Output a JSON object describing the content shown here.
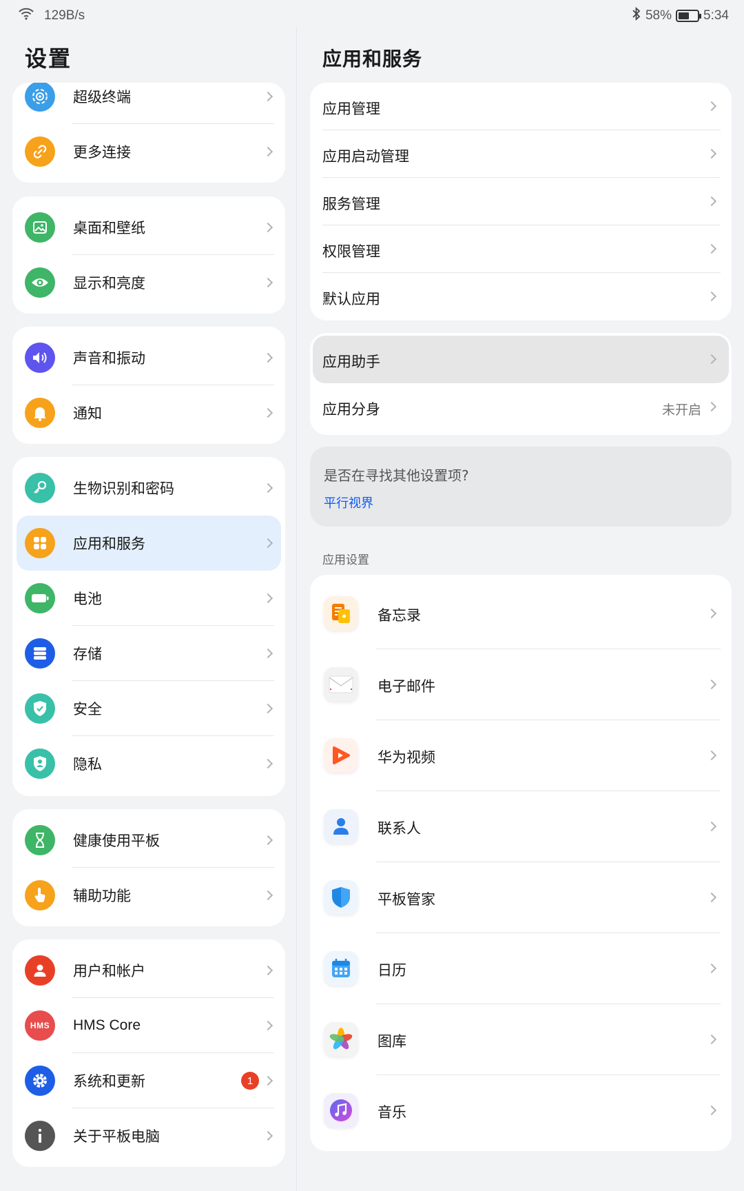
{
  "status": {
    "net_speed": "129B/s",
    "battery_pct": "58%",
    "battery_level": 0.58,
    "time": "5:34"
  },
  "left": {
    "title": "设置",
    "groups": [
      [
        {
          "label": "超级终端",
          "icon": "super-device-icon",
          "color": "#3b9ee8"
        },
        {
          "label": "更多连接",
          "icon": "link-icon",
          "color": "#f7a21b"
        }
      ],
      [
        {
          "label": "桌面和壁纸",
          "icon": "wallpaper-icon",
          "color": "#3fb567"
        },
        {
          "label": "显示和亮度",
          "icon": "eye-icon",
          "color": "#3fb567"
        }
      ],
      [
        {
          "label": "声音和振动",
          "icon": "speaker-icon",
          "color": "#5e55ee"
        },
        {
          "label": "通知",
          "icon": "bell-icon",
          "color": "#f7a21b"
        }
      ],
      [
        {
          "label": "生物识别和密码",
          "icon": "key-icon",
          "color": "#39c0a8"
        },
        {
          "label": "应用和服务",
          "icon": "apps-icon",
          "color": "#f7a21b"
        },
        {
          "label": "电池",
          "icon": "battery-icon",
          "color": "#3fb567"
        },
        {
          "label": "存储",
          "icon": "storage-icon",
          "color": "#1e5ee6"
        },
        {
          "label": "安全",
          "icon": "shield-check-icon",
          "color": "#39c0a8"
        },
        {
          "label": "隐私",
          "icon": "privacy-icon",
          "color": "#39c0a8"
        }
      ],
      [
        {
          "label": "健康使用平板",
          "icon": "hourglass-icon",
          "color": "#3fb567"
        },
        {
          "label": "辅助功能",
          "icon": "hand-icon",
          "color": "#f7a21b"
        }
      ],
      [
        {
          "label": "用户和帐户",
          "icon": "user-icon",
          "color": "#e84026"
        },
        {
          "label": "HMS Core",
          "icon": "hms-icon",
          "color": "#e84c4c",
          "icon_text": "HMS"
        },
        {
          "label": "系统和更新",
          "icon": "gear-icon",
          "color": "#1e5ee6",
          "badge": "1"
        },
        {
          "label": "关于平板电脑",
          "icon": "info-icon",
          "color": "#555555"
        }
      ]
    ]
  },
  "right": {
    "title": "应用和服务",
    "group1": [
      "应用管理",
      "应用启动管理",
      "服务管理",
      "权限管理",
      "默认应用"
    ],
    "group2": [
      {
        "label": "应用助手"
      },
      {
        "label": "应用分身",
        "value": "未开启"
      }
    ],
    "hint": {
      "question": "是否在寻找其他设置项?",
      "link": "平行视界"
    },
    "section_label": "应用设置",
    "apps": [
      {
        "label": "备忘录",
        "icon": "notepad-icon"
      },
      {
        "label": "电子邮件",
        "icon": "email-icon"
      },
      {
        "label": "华为视频",
        "icon": "video-icon"
      },
      {
        "label": "联系人",
        "icon": "contacts-icon"
      },
      {
        "label": "平板管家",
        "icon": "tablet-manager-icon"
      },
      {
        "label": "日历",
        "icon": "calendar-icon"
      },
      {
        "label": "图库",
        "icon": "gallery-icon"
      },
      {
        "label": "音乐",
        "icon": "music-icon"
      }
    ]
  }
}
